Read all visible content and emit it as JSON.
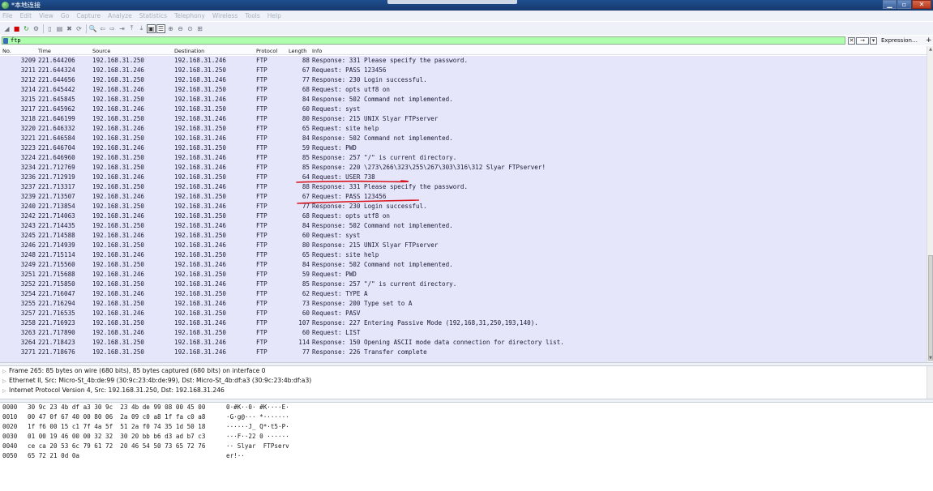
{
  "window": {
    "title": "*本地连接",
    "buttons": {
      "minimize": "▁",
      "maximize": "▫",
      "close": "✕"
    }
  },
  "menu": [
    "File",
    "Edit",
    "View",
    "Go",
    "Capture",
    "Analyze",
    "Statistics",
    "Telephony",
    "Wireless",
    "Tools",
    "Help"
  ],
  "toolbar": {
    "icons": [
      "shark-fin-icon",
      "stop-icon",
      "restart-icon",
      "options-icon",
      "open-file-icon",
      "save-icon",
      "close-file-icon",
      "reload-icon",
      "find-icon",
      "back-icon",
      "forward-icon",
      "go-to-icon",
      "first-icon",
      "last-icon",
      "autoscroll-icon",
      "colorize-icon",
      "zoom-in-icon",
      "zoom-out-icon",
      "zoom-reset-icon",
      "resize-columns-icon"
    ],
    "glyphs": [
      "◢",
      "■",
      "↻",
      "⚙",
      "▯",
      "▤",
      "✖",
      "⟳",
      "🔍",
      "⇦",
      "⇨",
      "⇥",
      "⤒",
      "⤓",
      "▣",
      "☰",
      "⊕",
      "⊖",
      "⊙",
      "⊞"
    ]
  },
  "filter": {
    "value": "ftp",
    "expression_label": "Expression…",
    "plus": "+",
    "clear_glyph": "✕",
    "arrow_glyph": "→",
    "dropdown_glyph": "▾"
  },
  "packet_list": {
    "columns": {
      "no": "No.",
      "time": "Time",
      "source": "Source",
      "destination": "Destination",
      "protocol": "Protocol",
      "length": "Length",
      "info": "Info"
    },
    "rows": [
      {
        "no": "3209",
        "time": "221.644206",
        "src": "192.168.31.250",
        "dst": "192.168.31.246",
        "proto": "FTP",
        "len": "88",
        "info": "Response: 331 Please specify the password."
      },
      {
        "no": "3211",
        "time": "221.644324",
        "src": "192.168.31.246",
        "dst": "192.168.31.250",
        "proto": "FTP",
        "len": "67",
        "info": "Request: PASS 123456"
      },
      {
        "no": "3212",
        "time": "221.644656",
        "src": "192.168.31.250",
        "dst": "192.168.31.246",
        "proto": "FTP",
        "len": "77",
        "info": "Response: 230 Login successful."
      },
      {
        "no": "3214",
        "time": "221.645442",
        "src": "192.168.31.246",
        "dst": "192.168.31.250",
        "proto": "FTP",
        "len": "68",
        "info": "Request: opts utf8 on"
      },
      {
        "no": "3215",
        "time": "221.645845",
        "src": "192.168.31.250",
        "dst": "192.168.31.246",
        "proto": "FTP",
        "len": "84",
        "info": "Response: 502 Command not implemented."
      },
      {
        "no": "3217",
        "time": "221.645962",
        "src": "192.168.31.246",
        "dst": "192.168.31.250",
        "proto": "FTP",
        "len": "60",
        "info": "Request: syst"
      },
      {
        "no": "3218",
        "time": "221.646199",
        "src": "192.168.31.250",
        "dst": "192.168.31.246",
        "proto": "FTP",
        "len": "80",
        "info": "Response: 215 UNIX Slyar FTPserver"
      },
      {
        "no": "3220",
        "time": "221.646332",
        "src": "192.168.31.246",
        "dst": "192.168.31.250",
        "proto": "FTP",
        "len": "65",
        "info": "Request: site help"
      },
      {
        "no": "3221",
        "time": "221.646584",
        "src": "192.168.31.250",
        "dst": "192.168.31.246",
        "proto": "FTP",
        "len": "84",
        "info": "Response: 502 Command not implemented."
      },
      {
        "no": "3223",
        "time": "221.646704",
        "src": "192.168.31.246",
        "dst": "192.168.31.250",
        "proto": "FTP",
        "len": "59",
        "info": "Request: PWD"
      },
      {
        "no": "3224",
        "time": "221.646960",
        "src": "192.168.31.250",
        "dst": "192.168.31.246",
        "proto": "FTP",
        "len": "85",
        "info": "Response: 257 \"/\" is current directory."
      },
      {
        "no": "3234",
        "time": "221.712769",
        "src": "192.168.31.250",
        "dst": "192.168.31.246",
        "proto": "FTP",
        "len": "85",
        "info": "Response: 220 \\273\\266\\323\\255\\267\\303\\316\\312 Slyar FTPserver!"
      },
      {
        "no": "3236",
        "time": "221.712919",
        "src": "192.168.31.246",
        "dst": "192.168.31.250",
        "proto": "FTP",
        "len": "64",
        "info": "Request: USER 738"
      },
      {
        "no": "3237",
        "time": "221.713317",
        "src": "192.168.31.250",
        "dst": "192.168.31.246",
        "proto": "FTP",
        "len": "88",
        "info": "Response: 331 Please specify the password."
      },
      {
        "no": "3239",
        "time": "221.713507",
        "src": "192.168.31.246",
        "dst": "192.168.31.250",
        "proto": "FTP",
        "len": "67",
        "info": "Request: PASS 123456"
      },
      {
        "no": "3240",
        "time": "221.713854",
        "src": "192.168.31.250",
        "dst": "192.168.31.246",
        "proto": "FTP",
        "len": "77",
        "info": "Response: 230 Login successful."
      },
      {
        "no": "3242",
        "time": "221.714063",
        "src": "192.168.31.246",
        "dst": "192.168.31.250",
        "proto": "FTP",
        "len": "68",
        "info": "Request: opts utf8 on"
      },
      {
        "no": "3243",
        "time": "221.714435",
        "src": "192.168.31.250",
        "dst": "192.168.31.246",
        "proto": "FTP",
        "len": "84",
        "info": "Response: 502 Command not implemented."
      },
      {
        "no": "3245",
        "time": "221.714588",
        "src": "192.168.31.246",
        "dst": "192.168.31.250",
        "proto": "FTP",
        "len": "60",
        "info": "Request: syst"
      },
      {
        "no": "3246",
        "time": "221.714939",
        "src": "192.168.31.250",
        "dst": "192.168.31.246",
        "proto": "FTP",
        "len": "80",
        "info": "Response: 215 UNIX Slyar FTPserver"
      },
      {
        "no": "3248",
        "time": "221.715114",
        "src": "192.168.31.246",
        "dst": "192.168.31.250",
        "proto": "FTP",
        "len": "65",
        "info": "Request: site help"
      },
      {
        "no": "3249",
        "time": "221.715560",
        "src": "192.168.31.250",
        "dst": "192.168.31.246",
        "proto": "FTP",
        "len": "84",
        "info": "Response: 502 Command not implemented."
      },
      {
        "no": "3251",
        "time": "221.715688",
        "src": "192.168.31.246",
        "dst": "192.168.31.250",
        "proto": "FTP",
        "len": "59",
        "info": "Request: PWD"
      },
      {
        "no": "3252",
        "time": "221.715850",
        "src": "192.168.31.250",
        "dst": "192.168.31.246",
        "proto": "FTP",
        "len": "85",
        "info": "Response: 257 \"/\" is current directory."
      },
      {
        "no": "3254",
        "time": "221.716047",
        "src": "192.168.31.246",
        "dst": "192.168.31.250",
        "proto": "FTP",
        "len": "62",
        "info": "Request: TYPE A"
      },
      {
        "no": "3255",
        "time": "221.716294",
        "src": "192.168.31.250",
        "dst": "192.168.31.246",
        "proto": "FTP",
        "len": "73",
        "info": "Response: 200 Type set to A"
      },
      {
        "no": "3257",
        "time": "221.716535",
        "src": "192.168.31.246",
        "dst": "192.168.31.250",
        "proto": "FTP",
        "len": "60",
        "info": "Request: PASV"
      },
      {
        "no": "3258",
        "time": "221.716923",
        "src": "192.168.31.250",
        "dst": "192.168.31.246",
        "proto": "FTP",
        "len": "107",
        "info": "Response: 227 Entering Passive Mode (192,168,31,250,193,140)."
      },
      {
        "no": "3263",
        "time": "221.717890",
        "src": "192.168.31.246",
        "dst": "192.168.31.250",
        "proto": "FTP",
        "len": "60",
        "info": "Request: LIST"
      },
      {
        "no": "3264",
        "time": "221.718423",
        "src": "192.168.31.250",
        "dst": "192.168.31.246",
        "proto": "FTP",
        "len": "114",
        "info": "Response: 150 Opening ASCII mode data connection for directory list."
      },
      {
        "no": "3271",
        "time": "221.718676",
        "src": "192.168.31.250",
        "dst": "192.168.31.246",
        "proto": "FTP",
        "len": "77",
        "info": "Response: 226 Transfer complete"
      }
    ],
    "annotation_color": "#d9141e",
    "row_color": "#e6e6fa"
  },
  "details": {
    "rows": [
      "Frame 265: 85 bytes on wire (680 bits), 85 bytes captured (680 bits) on interface 0",
      "Ethernet II, Src: Micro-St_4b:de:99 (30:9c:23:4b:de:99), Dst: Micro-St_4b:df:a3 (30:9c:23:4b:df:a3)",
      "Internet Protocol Version 4, Src: 192.168.31.250, Dst: 192.168.31.246"
    ]
  },
  "bytes": {
    "rows": [
      {
        "off": "0000",
        "hex": "30 9c 23 4b df a3 30 9c  23 4b de 99 08 00 45 00",
        "asc": "0·#K··0· #K····E·"
      },
      {
        "off": "0010",
        "hex": "00 47 0f 67 40 00 80 06  2a 09 c0 a8 1f fa c0 a8",
        "asc": "·G·g@··· *·······"
      },
      {
        "off": "0020",
        "hex": "1f f6 00 15 c1 7f 4a 5f  51 2a f0 74 35 1d 50 18",
        "asc": "······J_ Q*·t5·P·"
      },
      {
        "off": "0030",
        "hex": "01 00 19 46 00 00 32 32  30 20 bb b6 d3 ad b7 c3",
        "asc": "···F··22 0 ······"
      },
      {
        "off": "0040",
        "hex": "ce ca 20 53 6c 79 61 72  20 46 54 50 73 65 72 76",
        "asc": "·· Slyar  FTPserv"
      },
      {
        "off": "0050",
        "hex": "65 72 21 0d 0a",
        "asc": "er!··"
      }
    ]
  }
}
